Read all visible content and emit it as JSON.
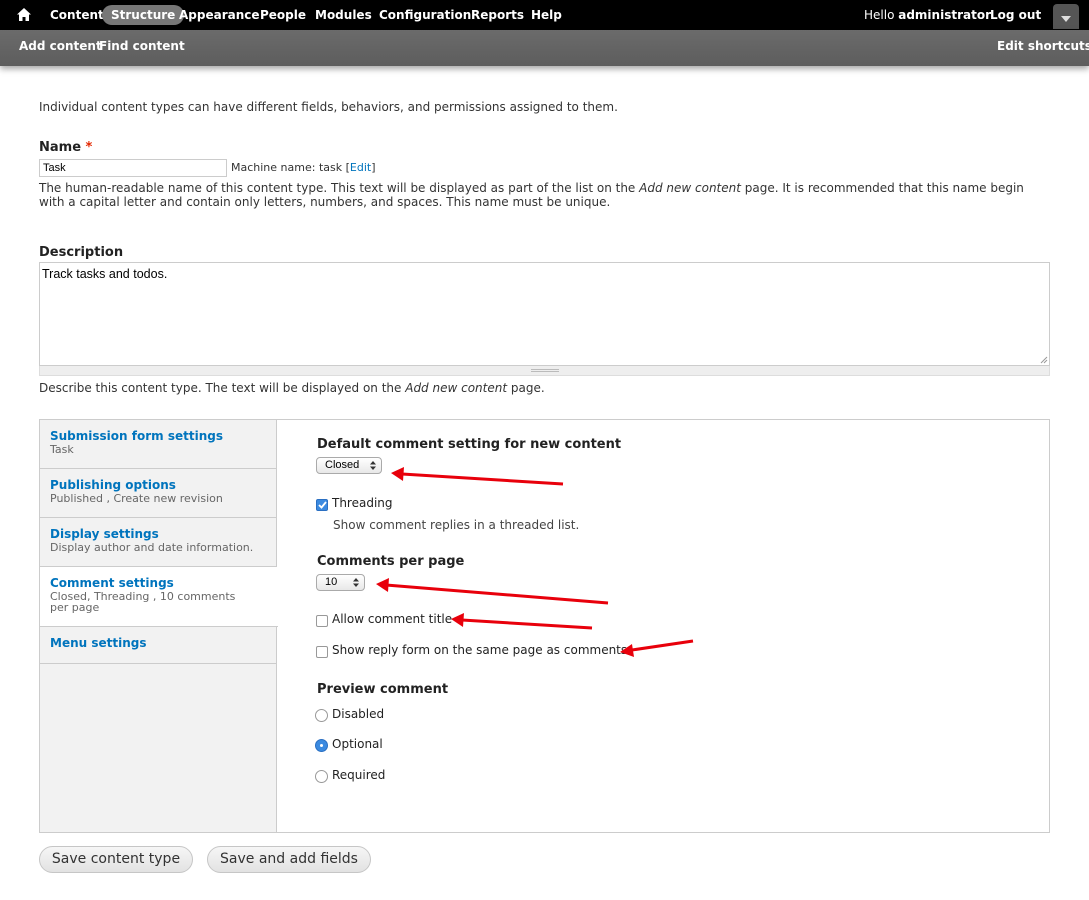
{
  "toolbar": {
    "nav": [
      "Content",
      "Structure",
      "Appearance",
      "People",
      "Modules",
      "Configuration",
      "Reports",
      "Help"
    ],
    "active": "Structure",
    "greeting_prefix": "Hello ",
    "user": "administrator",
    "logout": "Log out"
  },
  "shortcuts": {
    "items": [
      "Add content",
      "Find content"
    ],
    "edit": "Edit shortcuts"
  },
  "intro": "Individual content types can have different fields, behaviors, and permissions assigned to them.",
  "name_field": {
    "label": "Name",
    "required_marker": "*",
    "value": "Task",
    "machine_name_prefix": "Machine name: task [",
    "machine_name_edit": "Edit",
    "machine_name_suffix": "]",
    "help_1": "The human-readable name of this content type. This text will be displayed as part of the list on the ",
    "help_em": "Add new content",
    "help_2": " page. It is recommended that this name begin with a capital letter and contain only letters, numbers, and spaces. This name must be unique."
  },
  "description_field": {
    "label": "Description",
    "value": "Track tasks and todos.",
    "help_1": "Describe this content type. The text will be displayed on the ",
    "help_em": "Add new content",
    "help_2": " page."
  },
  "vertical_tabs": [
    {
      "title": "Submission form settings",
      "summary": "Task"
    },
    {
      "title": "Publishing options",
      "summary": "Published , Create new revision"
    },
    {
      "title": "Display settings",
      "summary": "Display author and date information."
    },
    {
      "title": "Comment settings",
      "summary": "Closed, Threading , 10 comments per page"
    },
    {
      "title": "Menu settings",
      "summary": ""
    }
  ],
  "comment_settings": {
    "default_label": "Default comment setting for new content",
    "default_value": "Closed",
    "threading_label": "Threading",
    "threading_checked": true,
    "threading_help": "Show comment replies in a threaded list.",
    "per_page_label": "Comments per page",
    "per_page_value": "10",
    "allow_title_label": "Allow comment title",
    "allow_title_checked": false,
    "reply_form_label": "Show reply form on the same page as comments",
    "reply_form_checked": false,
    "preview_label": "Preview comment",
    "preview_options": [
      "Disabled",
      "Optional",
      "Required"
    ],
    "preview_selected": "Optional"
  },
  "actions": {
    "save": "Save content type",
    "save_add_fields": "Save and add fields"
  },
  "colors": {
    "toolbar_bg": "#000000",
    "link": "#0074bd",
    "annotation_arrow": "#e8000b",
    "required": "#e32700"
  }
}
